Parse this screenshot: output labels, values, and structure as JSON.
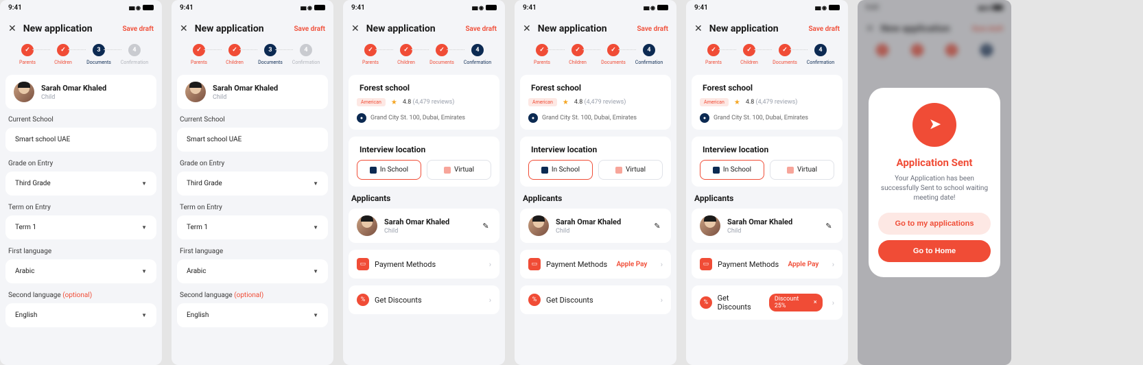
{
  "status_bar": {
    "time": "9:41"
  },
  "header": {
    "title": "New application",
    "save_draft": "Save draft"
  },
  "steps": {
    "s1": "Parents",
    "s2": "Children",
    "s3": "Documents",
    "s4": "Confirmation",
    "n3": "3",
    "n4": "4"
  },
  "person": {
    "name": "Sarah Omar Khaled",
    "role": "Child"
  },
  "form3": {
    "current_school_label": "Current School",
    "current_school_value": "Smart school UAE",
    "grade_label": "Grade on Entry",
    "grade_value": "Third Grade",
    "term_label": "Term on Entry",
    "term_value": "Term 1",
    "lang1_label": "First language",
    "lang1_value": "Arabic",
    "lang2_label": "Second language ",
    "lang2_optional": "(optional)",
    "lang2_value": "English"
  },
  "school": {
    "name": "Forest school",
    "type": "American",
    "rating": "4.8",
    "review_count": "(4,479 reviews)",
    "address": "Grand City St. 100, Dubai, Emirates"
  },
  "interview": {
    "label": "Interview location",
    "opt1": "In School",
    "opt2": "Virtual"
  },
  "applicants": {
    "label": "Applicants"
  },
  "nav": {
    "payment": "Payment Methods",
    "discounts": "Get Discounts",
    "apple_pay": "Apple Pay",
    "discount_chip": "Discount 25%"
  },
  "modal": {
    "title": "Application Sent",
    "text": "Your Application has been successfully Sent to school waiting meeting date!",
    "btn1": "Go to my applications",
    "btn2": "Go to Home"
  }
}
